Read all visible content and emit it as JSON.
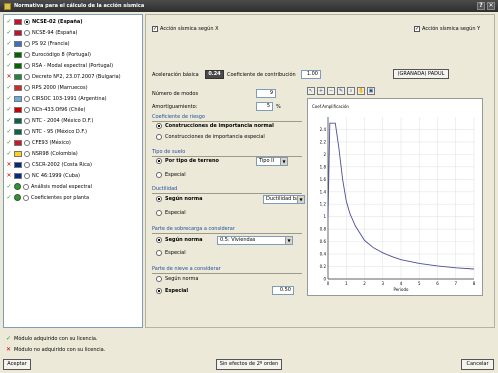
{
  "window": {
    "title": "Normativa para el cálculo de la acción sísmica",
    "help_label": "?",
    "close_label": "✕"
  },
  "norms": [
    {
      "status": "ok",
      "flag": "#c8102e",
      "selected": true,
      "label": "NCSE-02 (España)"
    },
    {
      "status": "ok",
      "flag": "#c8102e",
      "selected": false,
      "label": "NCSE-94 (España)"
    },
    {
      "status": "ok",
      "flag": "#3a6fc4",
      "selected": false,
      "label": "PS 92 (Francia)"
    },
    {
      "status": "ok",
      "flag": "#006600",
      "selected": false,
      "label": "Eurocódigo 8 (Portugal)"
    },
    {
      "status": "ok",
      "flag": "#006600",
      "selected": false,
      "label": "RSA - Modal espectral (Portugal)"
    },
    {
      "status": "no",
      "flag": "#1a8a3a",
      "selected": false,
      "label": "Decreto Nº2, 23.07.2007 (Bulgaria)"
    },
    {
      "status": "ok",
      "flag": "#cf2a2a",
      "selected": false,
      "label": "RPS 2000 (Marruecos)"
    },
    {
      "status": "ok",
      "flag": "#6fa8dc",
      "selected": false,
      "label": "CIRSOC 103-1991 (Argentina)"
    },
    {
      "status": "ok",
      "flag": "#cc0000",
      "selected": false,
      "label": "NCh-433.Of96 (Chile)"
    },
    {
      "status": "ok",
      "flag": "#006847",
      "selected": false,
      "label": "NTC - 2004 (México D.F.)"
    },
    {
      "status": "ok",
      "flag": "#006847",
      "selected": false,
      "label": "NTC - 95 (México D.F.)"
    },
    {
      "status": "ok",
      "flag": "#d91023",
      "selected": false,
      "label": "CFE93 (México)"
    },
    {
      "status": "ok",
      "flag": "#fcd116",
      "selected": false,
      "label": "NSR98 (Colombia)"
    },
    {
      "status": "no",
      "flag": "#002b7f",
      "selected": false,
      "label": "CSCR-2002 (Costa Rica)"
    },
    {
      "status": "no",
      "flag": "#002a8f",
      "selected": false,
      "label": "NC 46:1999 (Cuba)"
    },
    {
      "status": "ok",
      "globe": true,
      "selected": false,
      "label": "Análisis modal espectral"
    },
    {
      "status": "ok",
      "globe": true,
      "selected": false,
      "label": "Coeficientes por planta"
    }
  ],
  "params": {
    "sismo_x": "Acción sísmica según X",
    "sismo_y": "Acción sísmica según Y",
    "acel_label": "Aceleración básica",
    "acel_value": "0.24",
    "coef_label": "Coeficiente de contribución",
    "coef_value": "1.00",
    "city_button": "(GRANADA) PADUL",
    "modos_label": "Número de modos",
    "modos_value": "9",
    "amort_label": "Amortiguamiento:",
    "amort_value": "5",
    "amort_unit": "%"
  },
  "riesgo": {
    "title": "Coeficiente de riesgo",
    "opt1": "Construcciones de importancia normal",
    "opt2": "Construcciones de importancia especial"
  },
  "suelo": {
    "title": "Tipo de suelo",
    "opt1": "Por tipo de terreno",
    "combo": "Tipo II",
    "opt2": "Especial"
  },
  "ductilidad": {
    "title": "Ductilidad",
    "opt1": "Según norma",
    "combo": "Ductilidad baja",
    "opt2": "Especial"
  },
  "sobrecarga": {
    "title": "Parte de sobrecarga a considerar",
    "opt1": "Según norma",
    "combo": "0.5: Viviendas",
    "opt2": "Especial"
  },
  "nieve": {
    "title": "Parte de nieve a considerar",
    "opt1": "Según norma",
    "opt2": "Especial",
    "value": "0.50"
  },
  "chart_toolbar": [
    "cursor-icon",
    "zoom-in-icon",
    "zoom-out-icon",
    "pencil-icon",
    "magnifier-icon",
    "hand-icon",
    "fit-icon"
  ],
  "chart_data": {
    "type": "line",
    "ylabel": "Coef.Amplificación",
    "xlabel": "Periodo",
    "xlim": [
      0,
      8
    ],
    "ylim": [
      0,
      2.6
    ],
    "xticks": [
      "0",
      "1",
      "2",
      "3",
      "4",
      "5",
      "6",
      "7",
      "8"
    ],
    "yticks": [
      "0",
      "0.2",
      "0.4",
      "0.6",
      "0.8",
      "1",
      "1.2",
      "1.4",
      "1.6",
      "1.8",
      "2",
      "2.2",
      "2.4"
    ],
    "series": [
      {
        "x": [
          0,
          0.1,
          0.4,
          0.6,
          0.8,
          1.0,
          1.2,
          1.5,
          2.0,
          2.5,
          3.0,
          3.5,
          4.0,
          5.0,
          6.0,
          7.0,
          8.0
        ],
        "y": [
          1.0,
          2.5,
          2.5,
          2.1,
          1.6,
          1.25,
          1.05,
          0.85,
          0.62,
          0.5,
          0.42,
          0.36,
          0.31,
          0.25,
          0.21,
          0.18,
          0.16
        ]
      }
    ],
    "color": "#4b4f9a"
  },
  "legend": {
    "licensed": "Módulo adquirido con su licencia.",
    "unlicensed": "Módulo no adquirido con su licencia."
  },
  "buttons": {
    "accept": "Aceptar",
    "second_order": "Sin efectos de 2º orden",
    "cancel": "Cancelar"
  }
}
